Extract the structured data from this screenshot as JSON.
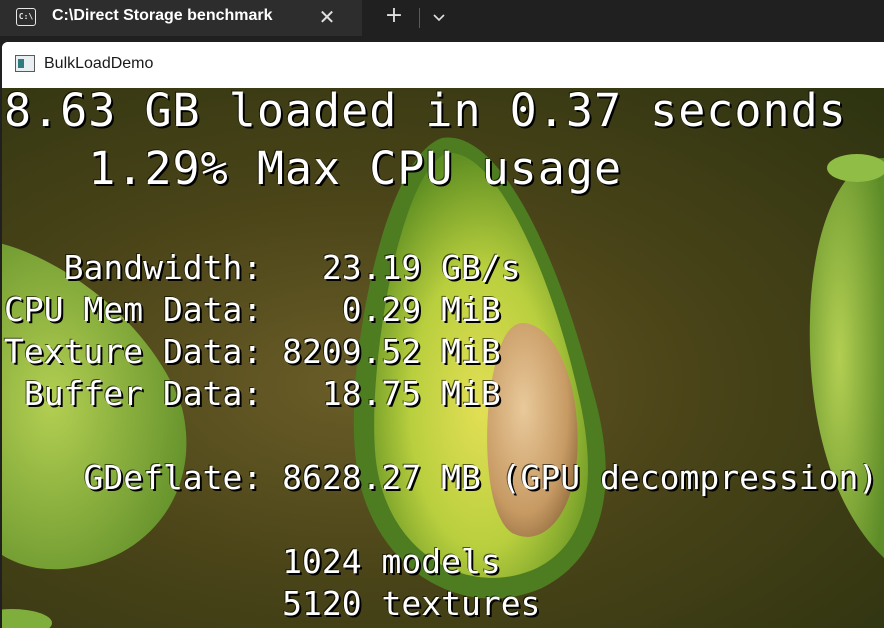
{
  "terminal": {
    "tab_title": "C:\\Direct Storage benchmark",
    "tab_icon_text": "C:\\",
    "close_glyph": "✕",
    "new_tab_glyph": "+"
  },
  "window": {
    "title": "BulkLoadDemo"
  },
  "stats": {
    "summary": "8.63 GB loaded in 0.37 seconds",
    "cpu": "   1.29% Max CPU usage",
    "bandwidth": "   Bandwidth:   23.19 GB/s",
    "cpu_mem": "CPU Mem Data:    0.29 MiB",
    "texture": "Texture Data: 8209.52 MiB",
    "buffer": " Buffer Data:   18.75 MiB",
    "gdeflate": "    GDeflate: 8628.27 MB (GPU decompression)",
    "models": "              1024 models",
    "textures": "              5120 textures"
  }
}
